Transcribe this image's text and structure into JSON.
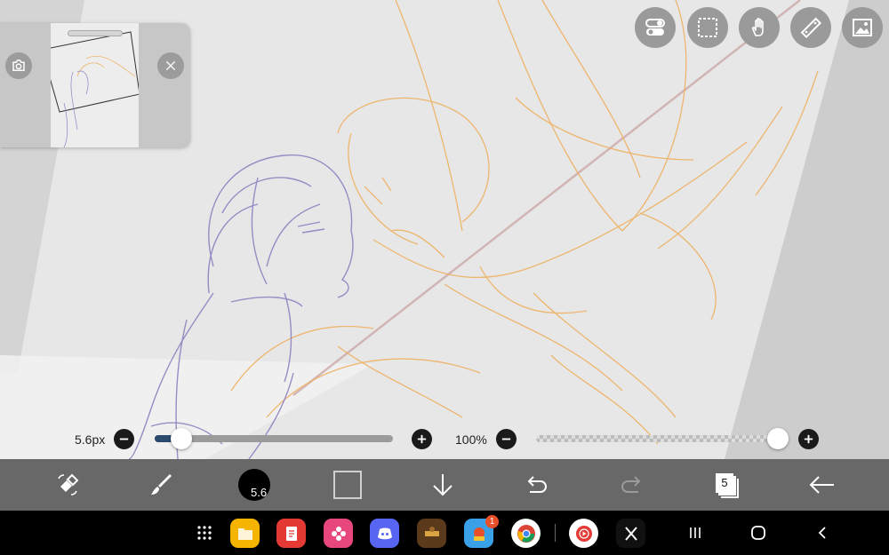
{
  "brush": {
    "size_label": "5.6px",
    "size_value": 5.6,
    "size_range": [
      0,
      50
    ],
    "size_badge": "5.6"
  },
  "opacity": {
    "label": "100%",
    "value": 100
  },
  "top_tools": [
    {
      "icon": "toggle-settings-icon"
    },
    {
      "icon": "selection-icon"
    },
    {
      "icon": "hand-icon"
    },
    {
      "icon": "ruler-icon"
    },
    {
      "icon": "image-icon"
    }
  ],
  "navigator": {
    "buttons": [
      {
        "icon": "camera-icon"
      },
      {
        "icon": "close-icon"
      }
    ]
  },
  "toolbar": {
    "items": [
      "transform-icon",
      "brush-icon",
      "brush-size",
      "color",
      "download-icon",
      "undo-icon",
      "redo-icon",
      "layers-icon",
      "back-icon"
    ],
    "layer_count": "5"
  },
  "taskbar": {
    "apps": [
      "apps-grid-icon",
      "files-icon",
      "notes-icon",
      "gallery-icon",
      "discord-icon",
      "game-icon",
      "game2-icon",
      "chrome-icon",
      "youtube-music-icon",
      "x-icon"
    ],
    "badge": "1"
  },
  "colors": {
    "accent": "#2c4a6e",
    "toolbar": "#686868",
    "sketch_purple": "#8e82c0",
    "sketch_orange": "#eeb060"
  }
}
